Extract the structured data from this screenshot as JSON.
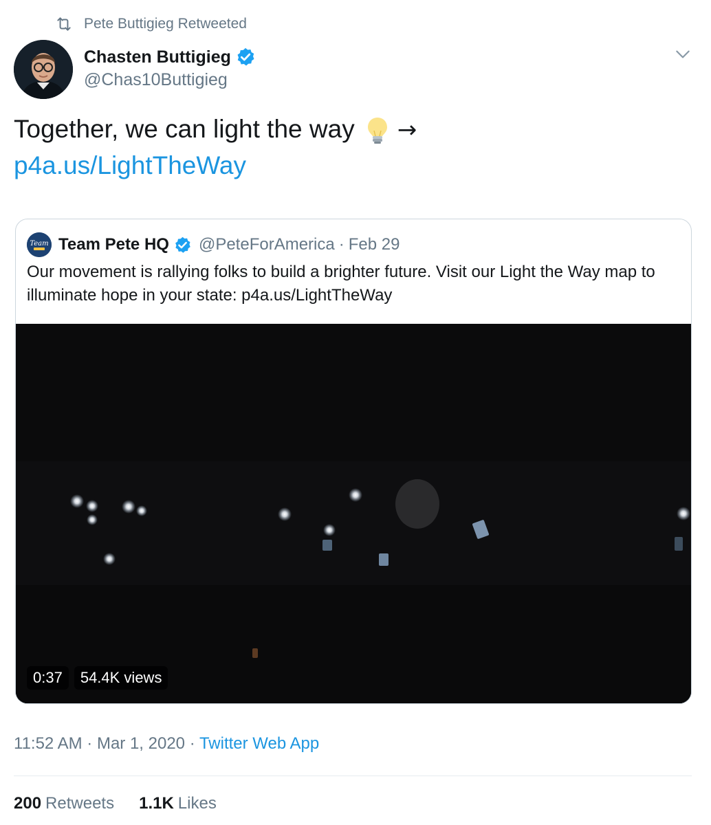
{
  "retweet_banner": {
    "icon": "retweet-icon",
    "text": "Pete Buttigieg Retweeted"
  },
  "author": {
    "display_name": "Chasten Buttigieg",
    "handle": "@Chas10Buttigieg",
    "verified_icon": "verified-badge-icon"
  },
  "menu_icon": "chevron-down-icon",
  "tweet": {
    "text": "Together, we can light the way",
    "emoji": "light-bulb-icon",
    "arrow": "→",
    "link": "p4a.us/LightTheWay"
  },
  "quoted_tweet": {
    "display_name": "Team Pete HQ",
    "handle": "@PeteForAmerica",
    "separator": "·",
    "date": "Feb 29",
    "avatar_text": "Team",
    "text": "Our movement is rallying folks to build a brighter future. Visit our Light the Way map to illuminate hope in your state: p4a.us/LightTheWay",
    "video": {
      "duration": "0:37",
      "views": "54.4K views"
    }
  },
  "meta": {
    "time": "11:52 AM",
    "separator1": " · ",
    "date": "Mar 1, 2020",
    "separator2": " · ",
    "source": "Twitter Web App"
  },
  "stats": {
    "retweets_count": "200",
    "retweets_label": "Retweets",
    "likes_count": "1.1K",
    "likes_label": "Likes"
  },
  "colors": {
    "link": "#1b95e0",
    "secondary_text": "#657786",
    "verified": "#1da1f2"
  }
}
